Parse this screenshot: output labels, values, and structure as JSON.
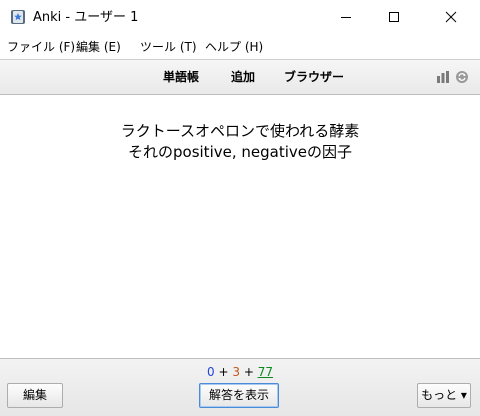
{
  "window": {
    "title": "Anki - ユーザー 1",
    "app_icon": "anki-star-icon"
  },
  "menu": {
    "items": [
      "ファイル (F)",
      "編集 (E)",
      "ツール (T)",
      "ヘルプ (H)"
    ]
  },
  "toolbar": {
    "links": [
      "単語帳",
      "追加",
      "ブラウザー"
    ],
    "icons": [
      "stats-icon",
      "sync-icon"
    ]
  },
  "card": {
    "lines": [
      "ラクトースオペロンで使われる酵素",
      "それのpositive, negativeの因子"
    ]
  },
  "bottom": {
    "counts": {
      "new": "0",
      "sep1": " + ",
      "learn": "3",
      "sep2": " + ",
      "review": "77"
    },
    "edit_label": "編集",
    "show_answer_label": "解答を表示",
    "more_label": "もっと ▾"
  },
  "colors": {
    "new_count": "#1f47d6",
    "learn_count": "#c35617",
    "review_count": "#0a8a1e",
    "focus_border": "#4a8ad8"
  }
}
